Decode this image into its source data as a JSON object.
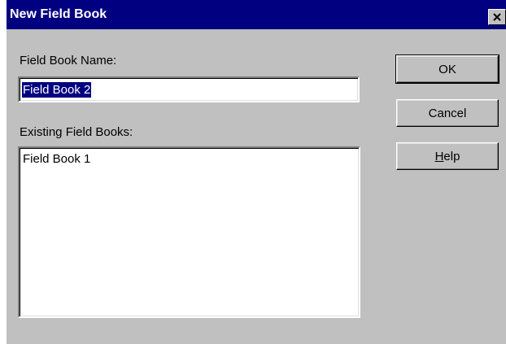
{
  "window": {
    "title": "New Field Book",
    "close_icon": "close-icon",
    "title_bar_color": "#000080",
    "face_color": "#c0c0c0"
  },
  "form": {
    "name_label": "Field Book Name:",
    "name_value": "Field Book 2",
    "existing_label": "Existing Field Books:",
    "existing_items": [
      "Field Book 1"
    ]
  },
  "buttons": {
    "ok": "OK",
    "cancel": "Cancel",
    "help_accel": "H",
    "help_rest": "elp"
  }
}
